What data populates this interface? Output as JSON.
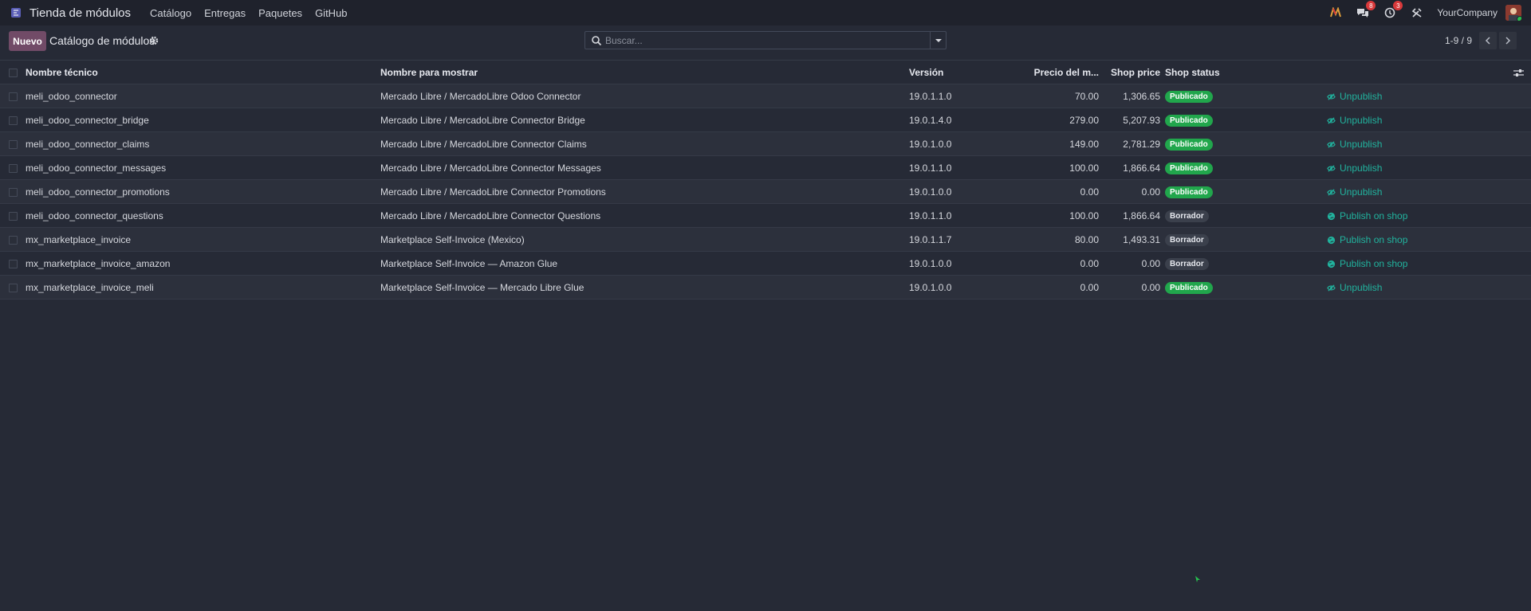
{
  "navbar": {
    "app_name": "Tienda de módulos",
    "menu": [
      "Catálogo",
      "Entregas",
      "Paquetes",
      "GitHub"
    ],
    "messages_count": "8",
    "activities_count": "3",
    "company": "YourCompany",
    "icons": [
      "app-icon",
      "odoo-logo-icon",
      "chat-icon",
      "clock-icon",
      "tools-icon",
      "avatar"
    ]
  },
  "control_panel": {
    "new_label": "Nuevo",
    "title": "Catálogo de módulos",
    "search_placeholder": "Buscar...",
    "pager": "1-9 / 9"
  },
  "table": {
    "columns": [
      "Nombre técnico",
      "Nombre para mostrar",
      "Versión",
      "Precio del m...",
      "Shop price",
      "Shop status"
    ],
    "rows": [
      {
        "tech": "meli_odoo_connector",
        "name": "Mercado Libre / MercadoLibre Odoo Connector",
        "version": "19.0.1.1.0",
        "price": "70.00",
        "shop_price": "1,306.65",
        "status": "Publicado",
        "action": "Unpublish"
      },
      {
        "tech": "meli_odoo_connector_bridge",
        "name": "Mercado Libre / MercadoLibre Connector Bridge",
        "version": "19.0.1.4.0",
        "price": "279.00",
        "shop_price": "5,207.93",
        "status": "Publicado",
        "action": "Unpublish"
      },
      {
        "tech": "meli_odoo_connector_claims",
        "name": "Mercado Libre / MercadoLibre Connector Claims",
        "version": "19.0.1.0.0",
        "price": "149.00",
        "shop_price": "2,781.29",
        "status": "Publicado",
        "action": "Unpublish"
      },
      {
        "tech": "meli_odoo_connector_messages",
        "name": "Mercado Libre / MercadoLibre Connector Messages",
        "version": "19.0.1.1.0",
        "price": "100.00",
        "shop_price": "1,866.64",
        "status": "Publicado",
        "action": "Unpublish"
      },
      {
        "tech": "meli_odoo_connector_promotions",
        "name": "Mercado Libre / MercadoLibre Connector Promotions",
        "version": "19.0.1.0.0",
        "price": "0.00",
        "shop_price": "0.00",
        "status": "Publicado",
        "action": "Unpublish"
      },
      {
        "tech": "meli_odoo_connector_questions",
        "name": "Mercado Libre / MercadoLibre Connector Questions",
        "version": "19.0.1.1.0",
        "price": "100.00",
        "shop_price": "1,866.64",
        "status": "Borrador",
        "action": "Publish on shop"
      },
      {
        "tech": "mx_marketplace_invoice",
        "name": "Marketplace Self-Invoice (Mexico)",
        "version": "19.0.1.1.7",
        "price": "80.00",
        "shop_price": "1,493.31",
        "status": "Borrador",
        "action": "Publish on shop"
      },
      {
        "tech": "mx_marketplace_invoice_amazon",
        "name": "Marketplace Self-Invoice — Amazon Glue",
        "version": "19.0.1.0.0",
        "price": "0.00",
        "shop_price": "0.00",
        "status": "Borrador",
        "action": "Publish on shop"
      },
      {
        "tech": "mx_marketplace_invoice_meli",
        "name": "Marketplace Self-Invoice — Mercado Libre Glue",
        "version": "19.0.1.0.0",
        "price": "0.00",
        "shop_price": "0.00",
        "status": "Publicado",
        "action": "Unpublish"
      }
    ]
  },
  "colors": {
    "accent": "#714b67",
    "published": "#21a64c",
    "link": "#21b39e",
    "background": "#262a36"
  }
}
